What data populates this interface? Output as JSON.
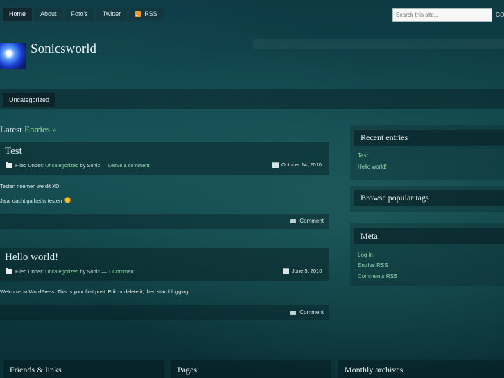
{
  "nav": {
    "tabs": [
      {
        "label": "Home"
      },
      {
        "label": "About"
      },
      {
        "label": "Foto's"
      },
      {
        "label": "Twitter"
      },
      {
        "label": "RSS"
      }
    ]
  },
  "search": {
    "placeholder": "Search this site...",
    "go_label": "GO"
  },
  "site": {
    "title": "Sonicsworld"
  },
  "categories": {
    "tab": "Uncategorized"
  },
  "main": {
    "latest_prefix": "Latest",
    "latest_accent": "Entries »",
    "posts": [
      {
        "title": "Test",
        "filed_under": "Filed Under:",
        "category": "Uncategorized",
        "by": "by Sonic —",
        "comment_link": "Leave a comment",
        "date": "October 14, 2010",
        "paragraphs": [
          "Testen noemen we dit XD",
          "Jaja, dacht ga het is testen"
        ],
        "comment_label": "Comment"
      },
      {
        "title": "Hello world!",
        "filed_under": "Filed Under:",
        "category": "Uncategorized",
        "by": "by Sonic —",
        "comment_link": "1 Comment",
        "date": "June 5, 2010",
        "paragraphs": [
          "Welcome to WordPress. This is your first post. Edit or delete it, then start blogging!"
        ],
        "comment_label": "Comment"
      }
    ]
  },
  "sidebar": {
    "recent": {
      "title": "Recent entries",
      "items": [
        "Test",
        "Hello world!"
      ]
    },
    "tags": {
      "title": "Browse popular tags"
    },
    "meta": {
      "title": "Meta",
      "items": [
        "Log in",
        "Entries RSS",
        "Comments RSS"
      ]
    }
  },
  "footer": {
    "friends": "Friends & links",
    "pages": "Pages",
    "archives": "Monthly archives"
  },
  "colors": {
    "link": "#8fd6a8",
    "background": "#0f4148"
  }
}
